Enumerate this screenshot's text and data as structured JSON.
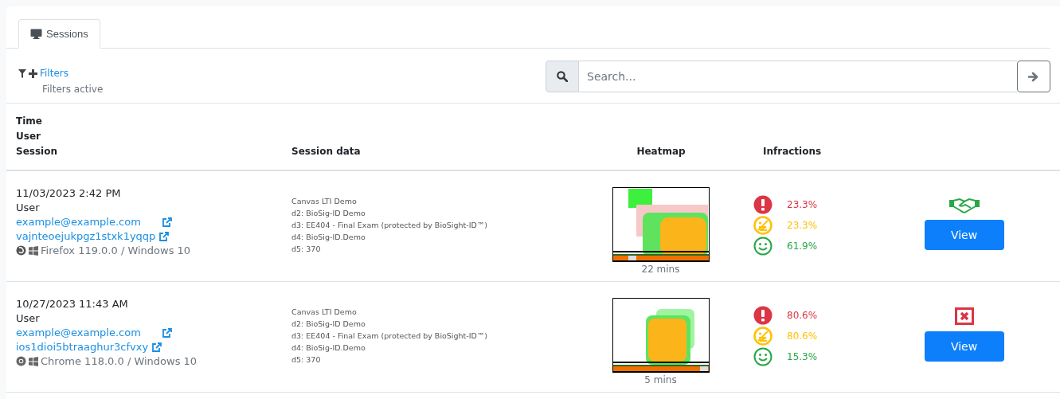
{
  "tabs": [
    {
      "label": "Sessions",
      "selected": true
    }
  ],
  "filters": {
    "link": "Filters",
    "note": "Filters active"
  },
  "search": {
    "placeholder": "Search..."
  },
  "table": {
    "columns": [
      {
        "lines": [
          "Time",
          "User",
          "Session"
        ]
      },
      {
        "lines": [
          "Session data"
        ]
      },
      {
        "lines": [
          "Heatmap"
        ]
      },
      {
        "lines": [
          "Infractions"
        ]
      }
    ],
    "rows": [
      {
        "time": "11/03/2023 2:42 PM",
        "user": "User",
        "email": "example@example.com",
        "session": "vajnteoejukpgz1stxk1yqqp",
        "browser_icon": {
          "kind": "firefox"
        },
        "platform": "Firefox 119.0.0 / Windows 10",
        "data": [
          "Canvas LTI Demo",
          "d2: BioSig-ID Demo",
          "d3: EE404 - Final Exam (protected by BioSight-ID™)",
          "d4: BioSig-ID.Demo",
          "d5: 370"
        ],
        "heatmap": {
          "kind": "picture",
          "duration": "22 mins"
        },
        "infractions": [
          {
            "kind": "alert",
            "value": "23.3%"
          },
          {
            "kind": "neutral",
            "value": "23.3%"
          },
          {
            "kind": "ok",
            "value": "61.9%"
          }
        ],
        "status_icon": {
          "kind": "handshake"
        },
        "action": "View"
      },
      {
        "time": "10/27/2023 11:43 AM",
        "user": "User",
        "email": "example@example.com",
        "session": "ios1dioi5btraaghur3cfvxy",
        "browser_icon": {
          "kind": "chrome"
        },
        "platform": "Chrome 118.0.0 / Windows 10",
        "data": [
          "Canvas LTI Demo",
          "d2: BioSig-ID Demo",
          "d3: EE404 - Final Exam (protected by BioSight-ID™)",
          "d4: BioSig-ID.Demo",
          "d5: 370"
        ],
        "heatmap": {
          "kind": "picture",
          "duration": "5 mins"
        },
        "infractions": [
          {
            "kind": "alert",
            "value": "80.6%"
          },
          {
            "kind": "neutral",
            "value": "80.6%"
          },
          {
            "kind": "ok",
            "value": "15.3%"
          }
        ],
        "status_icon": {
          "kind": "rejected"
        },
        "action": "View"
      }
    ]
  }
}
